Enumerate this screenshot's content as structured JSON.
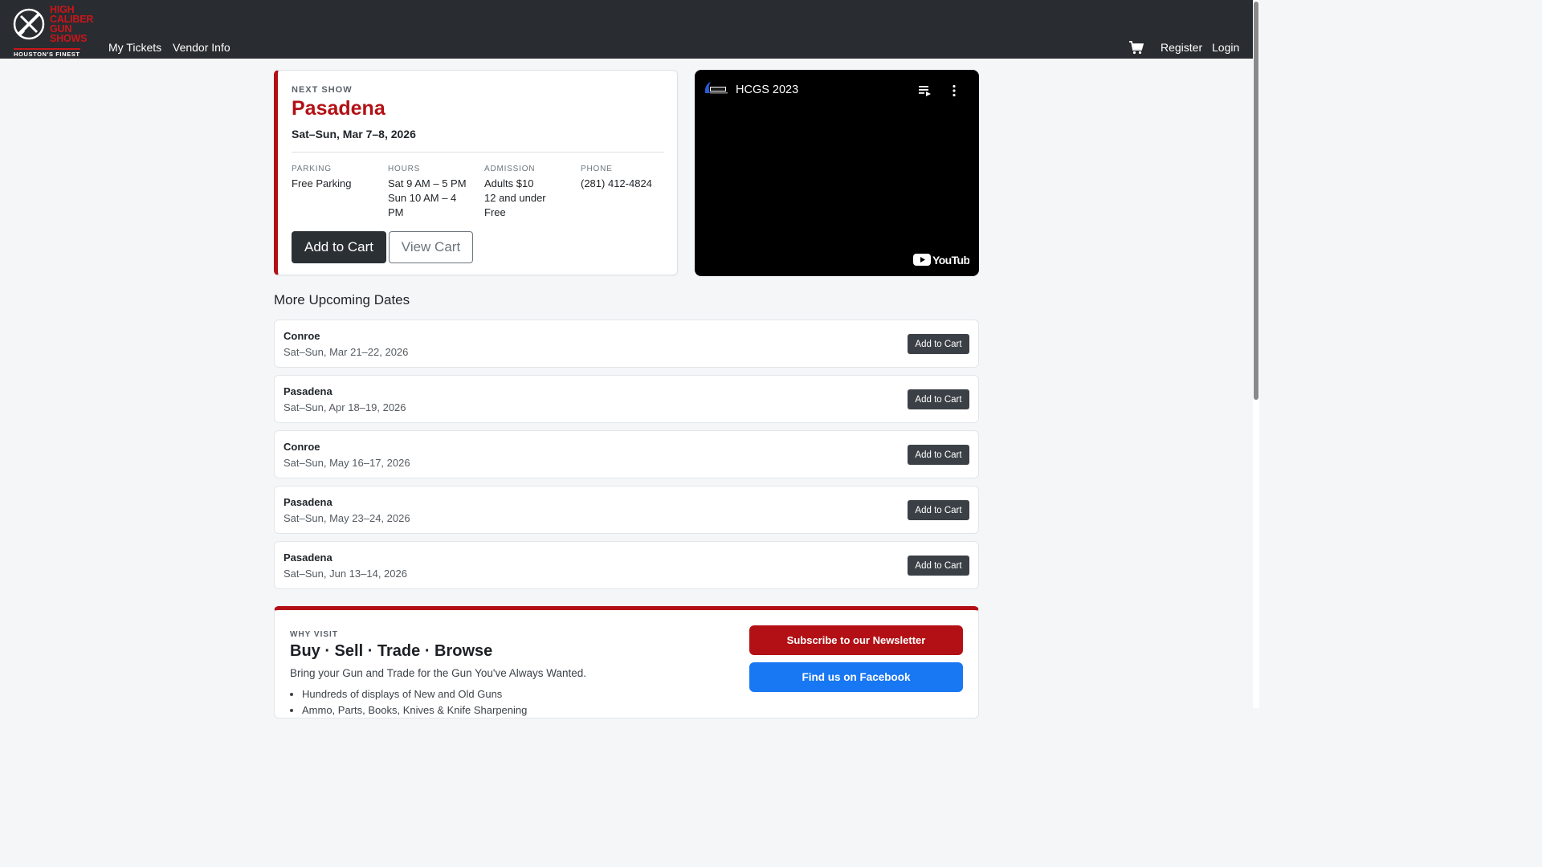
{
  "header": {
    "logo_lines": [
      "HIGH",
      "CALIBER",
      "GUN",
      "SHOWS"
    ],
    "logo_tagline": "HOUSTON'S FINEST",
    "nav": {
      "my_tickets": "My Tickets",
      "vendor_info": "Vendor Info"
    },
    "right": {
      "register": "Register",
      "login": "Login"
    },
    "brand_color": "#c9161b"
  },
  "next_show": {
    "eyebrow": "NEXT SHOW",
    "city": "Pasadena",
    "dates": "Sat–Sun, Mar 7–8, 2026",
    "parking": {
      "label": "PARKING",
      "value": "Free Parking"
    },
    "hours": {
      "label": "HOURS",
      "line1": "Sat 9 AM – 5 PM",
      "line2": "Sun 10 AM – 4",
      "line3": "PM"
    },
    "admission": {
      "label": "ADMISSION",
      "line1": "Adults $10",
      "line2": "12 and under",
      "line3": "Free"
    },
    "phone": {
      "label": "PHONE",
      "value": "(281) 412-4824"
    },
    "add_to_cart": "Add to Cart",
    "view_cart": "View Cart",
    "accent": "#b31015"
  },
  "video": {
    "title": "HCGS 2023",
    "platform": "YouTube"
  },
  "upcoming": {
    "title": "More Upcoming Dates",
    "button_label": "Add to Cart",
    "items": [
      {
        "city": "Conroe",
        "dates": "Sat–Sun, Mar 21–22, 2026"
      },
      {
        "city": "Pasadena",
        "dates": "Sat–Sun, Apr 18–19, 2026"
      },
      {
        "city": "Conroe",
        "dates": "Sat–Sun, May 16–17, 2026"
      },
      {
        "city": "Pasadena",
        "dates": "Sat–Sun, May 23–24, 2026"
      },
      {
        "city": "Pasadena",
        "dates": "Sat–Sun, Jun 13–14, 2026"
      }
    ]
  },
  "why_visit": {
    "eyebrow": "WHY VISIT",
    "headline": "Buy · Sell · Trade · Browse",
    "subline": "Bring your Gun and Trade for the Gun You've Always Wanted.",
    "bullets": [
      "Hundreds of displays of New and Old Guns",
      "Ammo, Parts, Books, Knives & Knife Sharpening"
    ],
    "newsletter_button": "Subscribe to our Newsletter",
    "facebook_button": "Find us on Facebook",
    "facebook_color": "#1877f2"
  }
}
